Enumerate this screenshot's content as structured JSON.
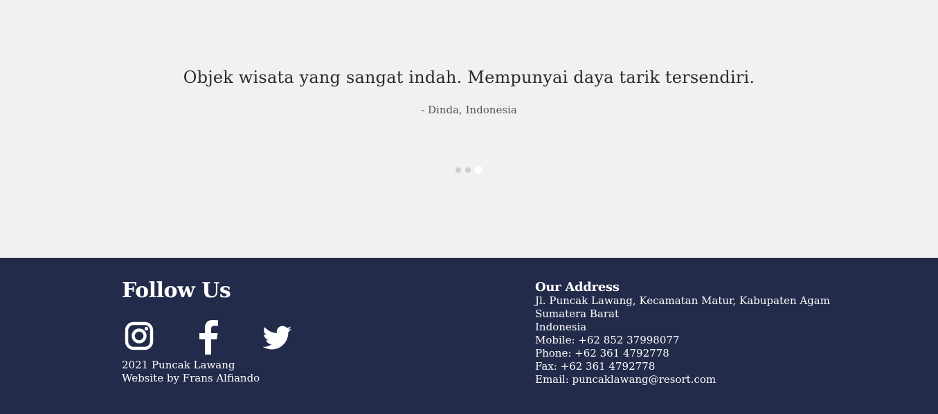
{
  "testimonial": {
    "quote": "Objek wisata yang sangat indah. Mempunyai daya tarik tersendiri.",
    "author": "- Dinda, Indonesia",
    "dots": [
      {
        "active": false
      },
      {
        "active": false
      },
      {
        "active": true
      }
    ]
  },
  "footer": {
    "follow_title": "Follow Us",
    "social": [
      {
        "icon": "instagram-icon"
      },
      {
        "icon": "facebook-icon"
      },
      {
        "icon": "twitter-icon"
      }
    ],
    "copyright": "2021 Puncak Lawang",
    "credit": "Website by Frans Alfiando",
    "address": {
      "title": "Our Address",
      "street": "Jl. Puncak Lawang, Kecamatan Matur, Kabupaten Agam",
      "province": "Sumatera Barat",
      "country": "Indonesia",
      "mobile": "Mobile: +62 852 37998077",
      "phone": "Phone: +62 361 4792778",
      "fax": "Fax: +62 361 4792778",
      "email": "Email: puncaklawang@resort.com"
    }
  },
  "colors": {
    "page_background": "#f1f1f1",
    "footer_background": "#232b4a",
    "footer_text": "#ffffff"
  }
}
